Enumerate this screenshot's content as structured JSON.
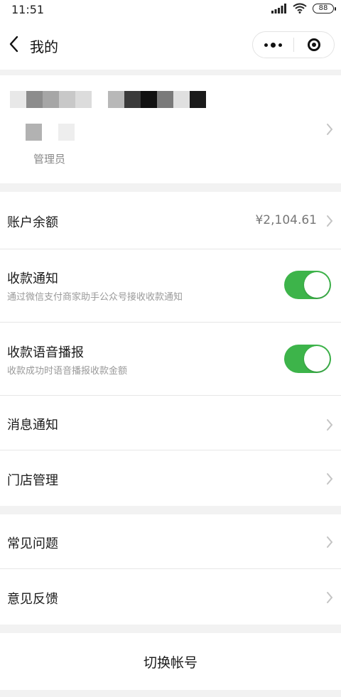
{
  "status_bar": {
    "time": "11:51",
    "battery": "88",
    "icons": [
      "signal-icon",
      "wifi-icon",
      "battery-icon"
    ]
  },
  "nav": {
    "title": "我的",
    "back_icon": "chevron-left-icon",
    "menu_icon": "more-dots-icon",
    "close_icon": "target-circle-icon"
  },
  "profile": {
    "role": "管理员",
    "name_pixels_row1": [
      "#e8e8e8",
      "#8c8c8c",
      "#a6a6a6",
      "#c8c8c8",
      "#dcdcdc",
      "#ffffff",
      "#b8b8b8",
      "#3a3a3a",
      "#111111",
      "#7a7a7a",
      "#e0e0e0",
      "#1a1a1a"
    ],
    "name_pixels_row2": [
      "#b2b2b2",
      "#ffffff",
      "#eeeeee"
    ]
  },
  "account": {
    "balance_label": "账户余额",
    "balance_value": "¥2,104.61"
  },
  "settings": {
    "payment_notify_label": "收款通知",
    "payment_notify_desc": "通过微信支付商家助手公众号接收收款通知",
    "payment_notify_on": true,
    "voice_broadcast_label": "收款语音播报",
    "voice_broadcast_desc": "收款成功时语音播报收款金额",
    "voice_broadcast_on": true,
    "message_notify_label": "消息通知",
    "store_manage_label": "门店管理"
  },
  "help": {
    "faq_label": "常见问题",
    "feedback_label": "意见反馈"
  },
  "switch_account_label": "切换帐号",
  "colors": {
    "toggle_on": "#3db44a",
    "background": "#f2f2f2"
  }
}
